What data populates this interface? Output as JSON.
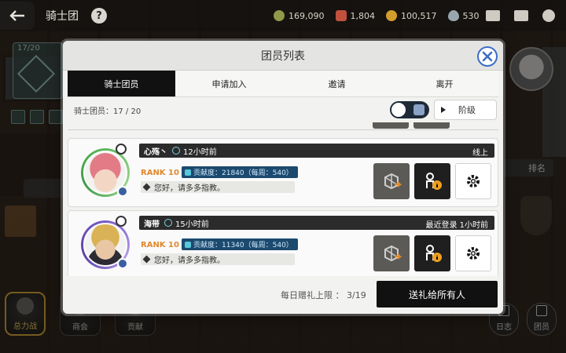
{
  "topbar": {
    "title": "骑士团",
    "currencies": [
      {
        "icon": "grimoire-coin-icon",
        "value": "169,090"
      },
      {
        "icon": "medal-icon",
        "value": "1,804"
      },
      {
        "icon": "gold-coin-icon",
        "value": "100,517"
      },
      {
        "icon": "mana-drop-icon",
        "value": "530"
      }
    ],
    "icons": [
      "mail-icon",
      "chat-icon",
      "emblem-icon"
    ]
  },
  "hud": {
    "guild_count": "17/20",
    "left_badge_count": "3",
    "bottom_nav": [
      {
        "label": "总力战",
        "active": true
      },
      {
        "label": "商会",
        "active": false
      },
      {
        "label": "贡献",
        "active": false
      }
    ],
    "right_tab_label": "排名",
    "right_buttons": [
      {
        "label": "日志"
      },
      {
        "label": "团员"
      }
    ]
  },
  "modal": {
    "title": "团员列表",
    "tabs": [
      {
        "label": "骑士团员",
        "active": true
      },
      {
        "label": "申请加入",
        "active": false
      },
      {
        "label": "邀请",
        "active": false
      },
      {
        "label": "离开",
        "active": false
      }
    ],
    "summary": "骑士团员：17 / 20",
    "sort_label": "阶级",
    "members": [
      {
        "name": "心殇丶",
        "last_time": "12小时前",
        "status": "线上",
        "rank": "RANK 10",
        "contribution": "贡献度：21840（每周：540）",
        "greeting": "您好，请多多指教。",
        "frame": "green"
      },
      {
        "name": "海带",
        "last_time": "15小时前",
        "status": "最近登录  1小时前",
        "rank": "RANK 10",
        "contribution": "贡献度：11340（每周：540）",
        "greeting": "您好，请多多指教。",
        "frame": "purple"
      }
    ],
    "footer": {
      "gift_limit": "每日赠礼上限 ： 3/19",
      "send_all": "送礼给所有人"
    }
  },
  "colors": {
    "accent_blue": "#3d6dc7",
    "rank_orange": "#e0892c",
    "contribution_bg": "#1c4a6e",
    "active_tab": "#111111"
  }
}
